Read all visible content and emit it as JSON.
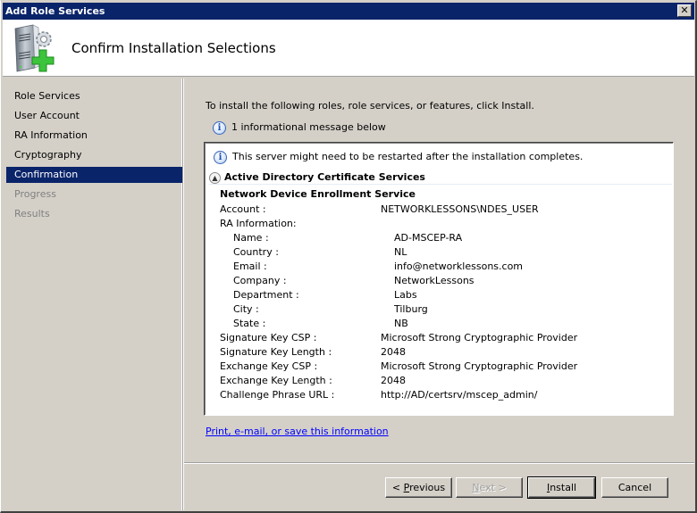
{
  "window": {
    "title": "Add Role Services",
    "close_label": "✕"
  },
  "header": {
    "title": "Confirm Installation Selections",
    "icon": "server-add-icon"
  },
  "sidebar": {
    "items": [
      {
        "label": "Role Services",
        "state": "normal"
      },
      {
        "label": "User Account",
        "state": "normal"
      },
      {
        "label": "RA Information",
        "state": "normal"
      },
      {
        "label": "Cryptography",
        "state": "normal"
      },
      {
        "label": "Confirmation",
        "state": "active"
      },
      {
        "label": "Progress",
        "state": "disabled"
      },
      {
        "label": "Results",
        "state": "disabled"
      }
    ]
  },
  "main": {
    "intro": "To install the following roles, role services, or features, click Install.",
    "info_message": "1 informational message below",
    "details": {
      "note": "This server might need to be restarted after the installation completes.",
      "section_title": "Active Directory Certificate Services",
      "service_name": "Network Device Enrollment Service",
      "account": {
        "key": "Account :",
        "value": "NETWORKLESSONS\\NDES_USER"
      },
      "ra_label": "RA Information:",
      "ra_fields": [
        {
          "key": "Name :",
          "value": "AD-MSCEP-RA"
        },
        {
          "key": "Country :",
          "value": "NL"
        },
        {
          "key": "Email :",
          "value": "info@networklessons.com"
        },
        {
          "key": "Company :",
          "value": "NetworkLessons"
        },
        {
          "key": "Department :",
          "value": "Labs"
        },
        {
          "key": "City :",
          "value": "Tilburg"
        },
        {
          "key": "State :",
          "value": "NB"
        }
      ],
      "crypto_fields": [
        {
          "key": "Signature Key CSP :",
          "value": "Microsoft Strong Cryptographic Provider"
        },
        {
          "key": "Signature Key Length :",
          "value": "2048"
        },
        {
          "key": "Exchange Key CSP :",
          "value": "Microsoft Strong Cryptographic Provider"
        },
        {
          "key": "Exchange Key Length :",
          "value": "2048"
        },
        {
          "key": "Challenge Phrase URL :",
          "value": "http://AD/certsrv/mscep_admin/"
        }
      ]
    },
    "link": "Print, e-mail, or save this information"
  },
  "buttons": {
    "previous": {
      "prefix": "< ",
      "accel": "P",
      "rest": "revious",
      "enabled": true
    },
    "next": {
      "accel": "N",
      "rest": "ext >",
      "enabled": false
    },
    "install": {
      "accel": "I",
      "rest": "nstall",
      "enabled": true,
      "default": true
    },
    "cancel": {
      "label": "Cancel",
      "enabled": true
    }
  }
}
